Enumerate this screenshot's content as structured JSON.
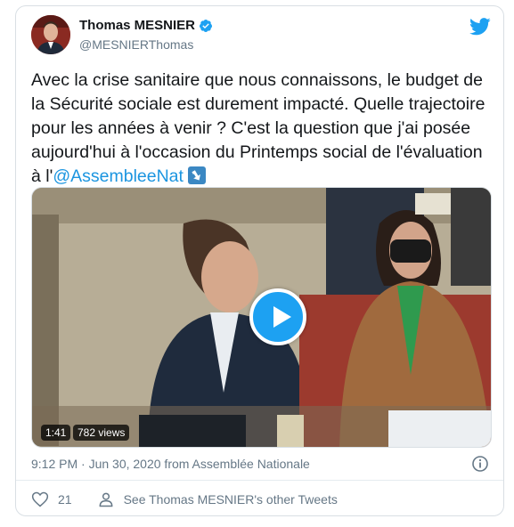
{
  "author": {
    "display_name": "Thomas MESNIER",
    "handle": "@MESNIERThomas",
    "verified_icon": "verified-badge-icon"
  },
  "tweet": {
    "text_before": "Avec la crise sanitaire que nous connaissons, le budget de la Sécurité sociale est durement impacté. Quelle trajectoire pour les années à venir ? C'est la question que j'ai posée aujourd'hui à l'occasion du Printemps social de l'évaluation à l'",
    "mention": "@AssembleeNat",
    "emoji_icon": "arrow-down-right-emoji"
  },
  "media": {
    "duration": "1:41",
    "views": "782 views",
    "play_icon": "play-icon"
  },
  "meta": {
    "timestamp": "9:12 PM · Jun 30, 2020 from Assemblée Nationale"
  },
  "actions": {
    "like_count": "21",
    "see_more": "See Thomas MESNIER's other Tweets"
  },
  "colors": {
    "accent": "#1da1f2",
    "link": "#1b95e0",
    "secondary_text": "#657786"
  }
}
